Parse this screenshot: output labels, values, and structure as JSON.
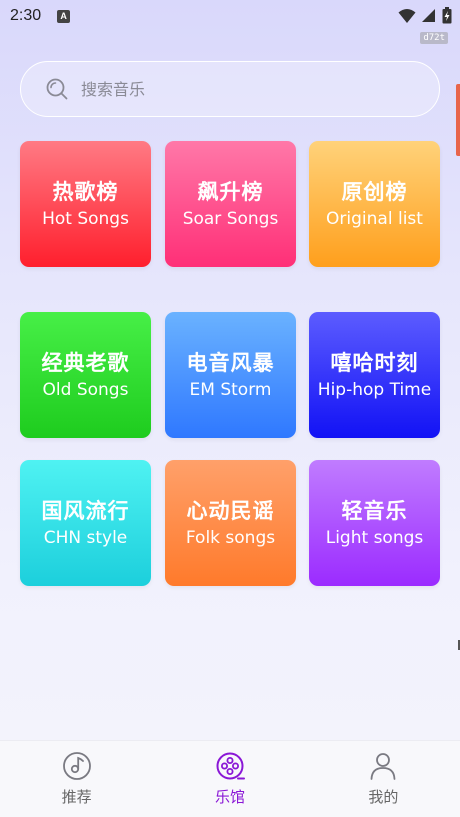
{
  "status_bar": {
    "time": "2:30",
    "badge": "d72t"
  },
  "search": {
    "placeholder": "搜索音乐"
  },
  "categories": [
    {
      "cn": "热歌榜",
      "en": "Hot Songs"
    },
    {
      "cn": "飙升榜",
      "en": "Soar Songs"
    },
    {
      "cn": "原创榜",
      "en": "Original list"
    },
    {
      "cn": "经典老歌",
      "en": "Old Songs"
    },
    {
      "cn": "电音风暴",
      "en": "EM Storm"
    },
    {
      "cn": "嘻哈时刻",
      "en": "Hip-hop Time"
    },
    {
      "cn": "国风流行",
      "en": "CHN style"
    },
    {
      "cn": "心动民谣",
      "en": "Folk songs"
    },
    {
      "cn": "轻音乐",
      "en": "Light songs"
    }
  ],
  "nav": [
    {
      "label": "推荐",
      "icon": "music-note-disc-icon"
    },
    {
      "label": "乐馆",
      "icon": "music-hall-reel-icon",
      "active": true
    },
    {
      "label": "我的",
      "icon": "person-icon"
    }
  ],
  "colors": {
    "active_nav": "#8a17d6",
    "inactive_nav": "#666666"
  }
}
